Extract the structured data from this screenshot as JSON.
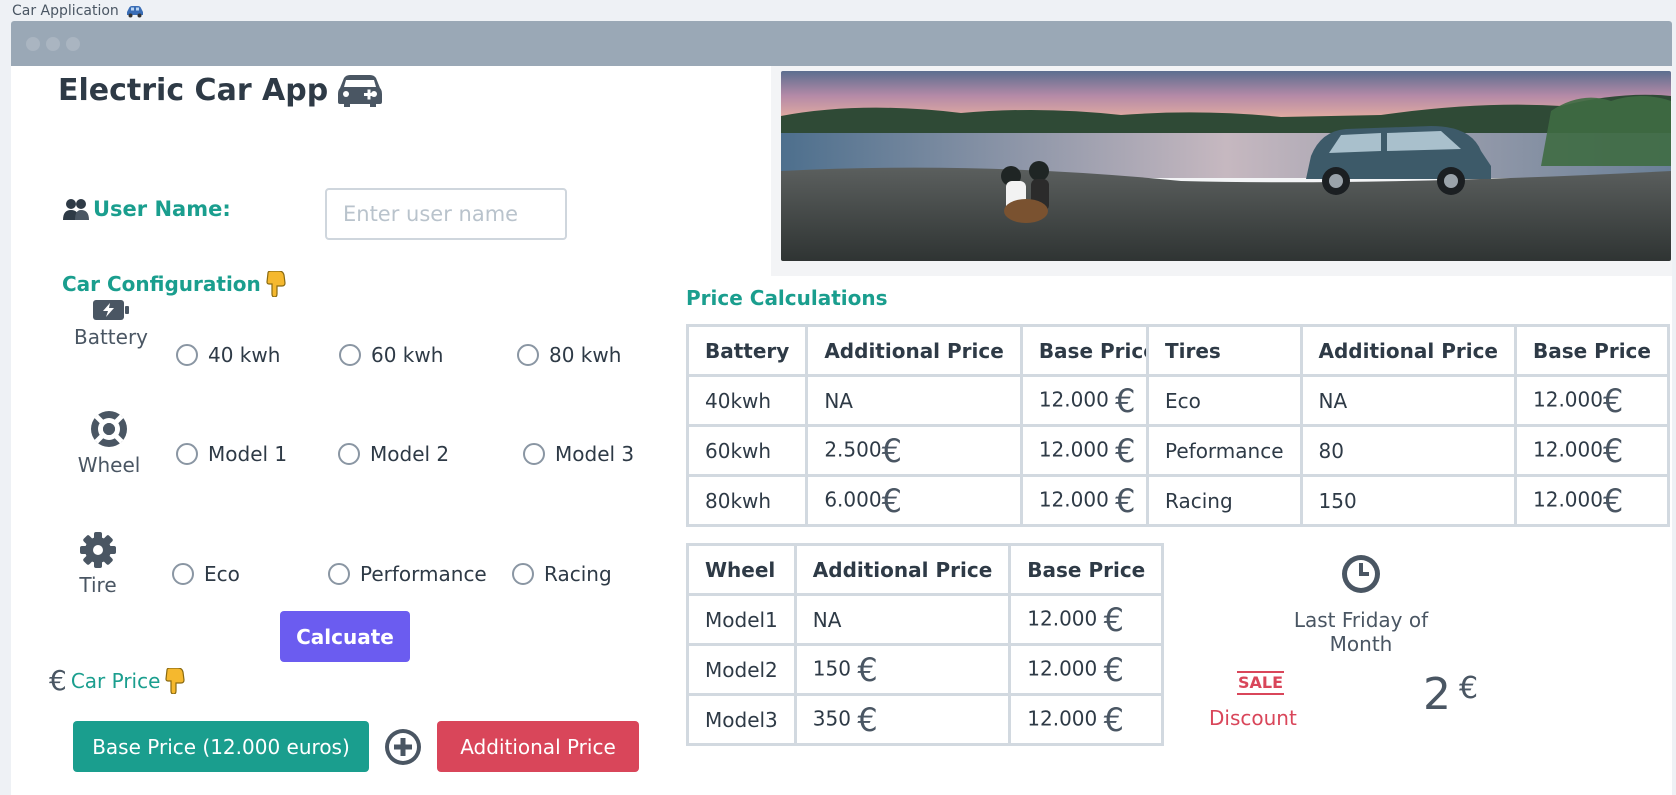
{
  "app_label": "Car Application",
  "title": "Electric Car App",
  "user": {
    "label": "User Name:",
    "placeholder": "Enter user name"
  },
  "config": {
    "title": "Car Configuration",
    "battery": {
      "label": "Battery",
      "options": [
        "40 kwh",
        "60 kwh",
        "80 kwh"
      ]
    },
    "wheel": {
      "label": "Wheel",
      "options": [
        "Model 1",
        "Model 2",
        "Model 3"
      ]
    },
    "tire": {
      "label": "Tire",
      "options": [
        "Eco",
        "Performance",
        "Racing"
      ]
    }
  },
  "calculate_label": "Calcuate",
  "car_price_title": "Car Price",
  "base_price_label": "Base Price (12.000 euros)",
  "additional_price_label": "Additional Price",
  "price_calc_title": "Price Calculations",
  "battery_table": {
    "headers": [
      "Battery",
      "Additional Price",
      "Base Price"
    ],
    "rows": [
      [
        "40kwh",
        "NA",
        "12.000"
      ],
      [
        "60kwh",
        "2.500",
        "12.000"
      ],
      [
        "80kwh",
        "6.000",
        "12.000"
      ]
    ]
  },
  "tires_table": {
    "headers": [
      "Tires",
      "Additional Price",
      "Base Price"
    ],
    "rows": [
      [
        "Eco",
        "NA",
        "12.000"
      ],
      [
        "Peformance",
        "80",
        "12.000"
      ],
      [
        "Racing",
        "150",
        "12.000"
      ]
    ]
  },
  "wheel_table": {
    "headers": [
      "Wheel",
      "Additional Price",
      "Base Price"
    ],
    "rows": [
      [
        "Model1",
        "NA",
        "12.000"
      ],
      [
        "Model2",
        "150",
        "12.000"
      ],
      [
        "Model3",
        "350",
        "12.000"
      ]
    ]
  },
  "schedule": "Last Friday of Month",
  "sale_badge": "SALE",
  "discount_label": "Discount",
  "discount_value": "2",
  "currency": "€",
  "colors": {
    "teal": "#1a9e8e",
    "purple": "#6b5cf0",
    "red": "#d9465a"
  }
}
